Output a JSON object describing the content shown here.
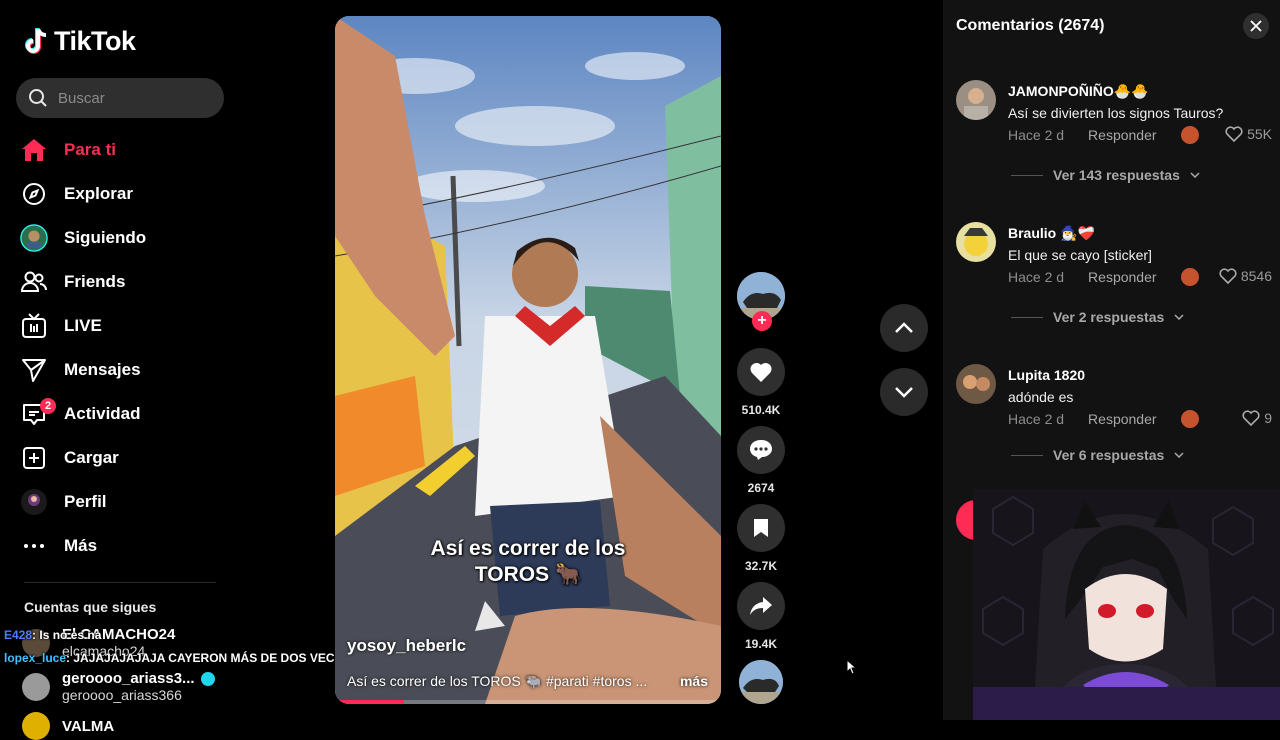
{
  "brand": {
    "name": "TikTok"
  },
  "search": {
    "placeholder": "Buscar"
  },
  "nav": {
    "items": [
      {
        "label": "Para ti",
        "icon": "home-icon",
        "active": true
      },
      {
        "label": "Explorar",
        "icon": "compass-icon"
      },
      {
        "label": "Siguiendo",
        "icon": "following-avatar-icon"
      },
      {
        "label": "Friends",
        "icon": "friends-icon"
      },
      {
        "label": "LIVE",
        "icon": "live-tv-icon"
      },
      {
        "label": "Mensajes",
        "icon": "send-icon"
      },
      {
        "label": "Actividad",
        "icon": "activity-icon",
        "badge": "2"
      },
      {
        "label": "Cargar",
        "icon": "upload-plus-icon"
      },
      {
        "label": "Perfil",
        "icon": "profile-avatar-icon"
      },
      {
        "label": "Más",
        "icon": "more-dots-icon"
      }
    ]
  },
  "following": {
    "title": "Cuentas que sigues",
    "accounts": [
      {
        "name": "El CAMACHO24",
        "handle": "elcamacho24"
      },
      {
        "name": "geroooo_ariass3...",
        "handle": "geroooo_ariass366",
        "verified": true
      },
      {
        "name": "VALMA"
      }
    ]
  },
  "chat_overlay": [
    {
      "user": "E428",
      "message": ": Is no es na"
    },
    {
      "user": "lopex_luce",
      "message": ": JAJAJAJAJAJA CAYERON MÁS DE DOS VECES"
    }
  ],
  "video": {
    "caption_overlay_line1": "Así es correr de los",
    "caption_overlay_line2": "TOROS 🐂",
    "author": "yosoy_heberlc",
    "description": "Así es correr de los TOROS 🐃 #parati #toros ...",
    "more_label": "más",
    "progress_fraction": 0.18
  },
  "actions": {
    "likes": "510.4K",
    "comments": "2674",
    "saves": "32.7K",
    "shares": "19.4K"
  },
  "comments": {
    "title": "Comentarios",
    "count": "(2674)",
    "items": [
      {
        "user": "JAMONPOÑIÑO🐣🐣",
        "text": "Así se divierten los signos Tauros?",
        "time": "Hace 2 d",
        "reply": "Responder",
        "likes": "55K",
        "replies": "Ver 143 respuestas"
      },
      {
        "user": "Braulio 🧙‍♂️❤️‍🩹",
        "text": "El que se cayo [sticker]",
        "time": "Hace 2 d",
        "reply": "Responder",
        "likes": "8546",
        "replies": "Ver 2 respuestas"
      },
      {
        "user": "Lupita 1820",
        "text": "adónde es",
        "time": "Hace 2 d",
        "reply": "Responder",
        "likes": "9",
        "replies": "Ver 6 respuestas"
      }
    ]
  },
  "colors": {
    "accent": "#fe2c55",
    "panel": "#121212",
    "button": "#2f2f2f",
    "verified": "#20d5ec"
  }
}
